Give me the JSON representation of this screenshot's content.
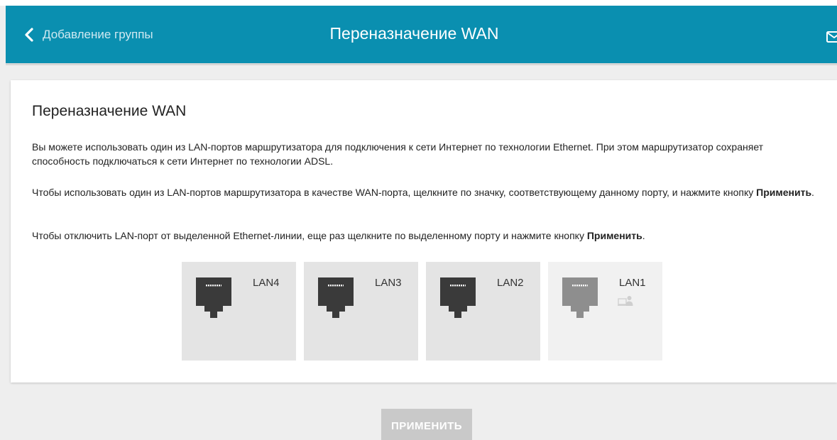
{
  "header": {
    "back_label": "Добавление группы",
    "title": "Переназначение WAN",
    "bg_color": "#0a8fb0"
  },
  "card": {
    "title": "Переназначение WAN",
    "p1": "Вы можете использовать один из LAN-портов маршрутизатора для подключения к сети Интернет по технологии Ethernet. При этом маршрутизатор сохраняет способность подключаться к сети Интернет по технологии ADSL.",
    "p2_text": "Чтобы использовать один из LAN-портов маршрутизатора в качестве WAN-порта, щелкните по значку, соответствующему данному порту, и нажмите кнопку ",
    "p2_bold": "Применить",
    "p2_end": ".",
    "p3_text": "Чтобы отключить LAN-порт от выделенной Ethernet-линии, еще раз щелкните по выделенному порту и нажмите кнопку ",
    "p3_bold": "Применить",
    "p3_end": "."
  },
  "ports": [
    {
      "label": "LAN4",
      "state": "available",
      "icon": "ethernet-port-icon"
    },
    {
      "label": "LAN3",
      "state": "available",
      "icon": "ethernet-port-icon"
    },
    {
      "label": "LAN2",
      "state": "available",
      "icon": "ethernet-port-icon"
    },
    {
      "label": "LAN1",
      "state": "in-use-by-client",
      "icon": "ethernet-port-icon",
      "extra_icon": "connected-client-icon"
    }
  ],
  "apply_button": {
    "label": "ПРИМЕНИТЬ",
    "enabled": false
  },
  "icons": {
    "back": "chevron-left-icon",
    "mail": "mail-icon"
  }
}
